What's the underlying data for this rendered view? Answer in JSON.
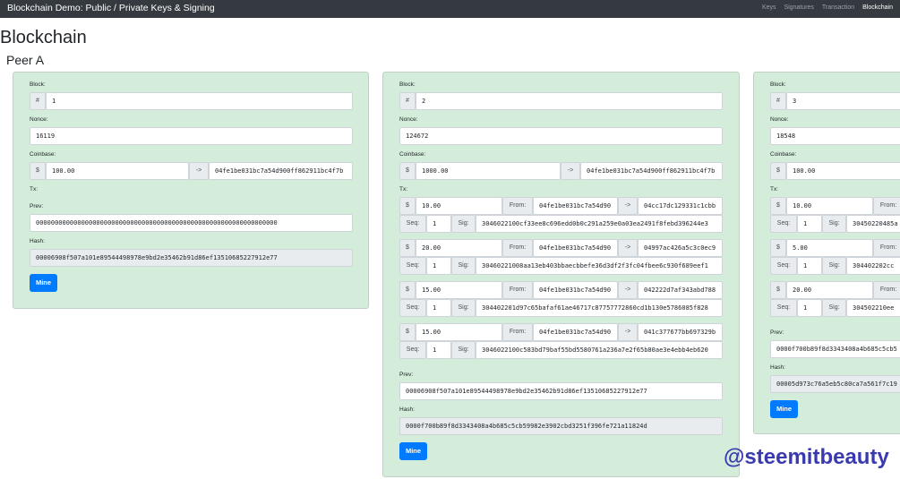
{
  "navbar": {
    "brand": "Blockchain Demo: Public / Private Keys & Signing",
    "links": [
      "Keys",
      "Signatures",
      "Transaction",
      "Blockchain"
    ],
    "active": "Blockchain"
  },
  "page_title": "Blockchain",
  "peer_title": "Peer A",
  "labels": {
    "block": "Block:",
    "nonce": "Nonce:",
    "coinbase": "Coinbase:",
    "tx": "Tx:",
    "prev": "Prev:",
    "hash": "Hash:",
    "hash_prefix": "#",
    "dollar": "$",
    "arrow": "->",
    "from": "From:",
    "seq": "Seq:",
    "sig": "Sig:",
    "mine": "Mine"
  },
  "blocks": [
    {
      "block": "1",
      "nonce": "16119",
      "coinbase": {
        "amount": "100.00",
        "to": "04fe1be031bc7a54d900ff862911bc4f7b"
      },
      "txs": [],
      "prev": "0000000000000000000000000000000000000000000000000000000000000000",
      "hash": "00006908f507a101e89544498978e9bd2e35462b91d86ef135106852279​12e77"
    },
    {
      "block": "2",
      "nonce": "124672",
      "coinbase": {
        "amount": "1000.00",
        "to": "04fe1be031bc7a54d900ff862911bc4f7b"
      },
      "txs": [
        {
          "amount": "10.00",
          "from": "04fe1be031bc7a54d90",
          "to": "04cc17dc129331c1cbb",
          "seq": "1",
          "sig": "3046022100cf33ee8c696edd0b0c291a259e0a03ea2491f8febd396244e3"
        },
        {
          "amount": "20.00",
          "from": "04fe1be031bc7a54d90",
          "to": "04997ac426a5c3c0ec9",
          "seq": "1",
          "sig": "30460221008aa13eb403bbaecbbefe36d3df2f3fc04fbee6c930f689eef1"
        },
        {
          "amount": "15.00",
          "from": "04fe1be031bc7a54d90",
          "to": "042222d7af343abd788",
          "seq": "1",
          "sig": "304402201d97c65bafaf61ae46717c87757772860cd1b130e5786085f828"
        },
        {
          "amount": "15.00",
          "from": "04fe1be031bc7a54d90",
          "to": "041c377677bb697329b",
          "seq": "1",
          "sig": "3046022100c583bd79baf55bd5580761a236a7e2f65b80ae3e4ebb4eb620"
        }
      ],
      "prev": "00006908f507a101e89544498978e9bd2e35462b91d86ef13510685227912e77",
      "hash": "0000f700b89f8d3343408a4b685c5cb59982e3902cbd3251f396fe721a11824d"
    },
    {
      "block": "3",
      "nonce": "18548",
      "coinbase": {
        "amount": "100.00",
        "to": ""
      },
      "txs": [
        {
          "amount": "10.00",
          "from": "",
          "to": "",
          "seq": "1",
          "sig": "30450220485a"
        },
        {
          "amount": "5.00",
          "from": "",
          "to": "",
          "seq": "1",
          "sig": "304402202cc"
        },
        {
          "amount": "20.00",
          "from": "",
          "to": "",
          "seq": "1",
          "sig": "304502210ee"
        }
      ],
      "prev": "0000f700b89f8d3343408a4b685c5cb5",
      "hash": "00005d973c76a5eb5c80ca7a561f7c19"
    }
  ],
  "watermark": "@steemitbeauty",
  "colors": {
    "navbar": "#343a40",
    "card": "#d4edda",
    "mine_button": "#007bff",
    "watermark": "#3a3ab0"
  }
}
